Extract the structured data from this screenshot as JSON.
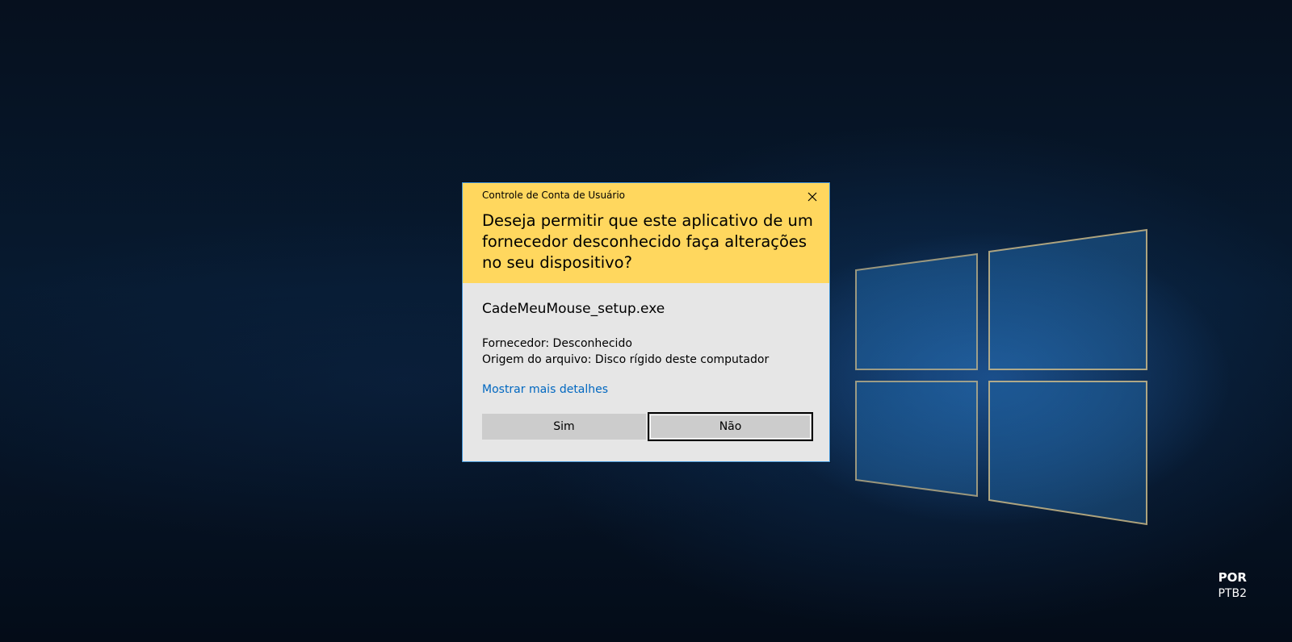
{
  "dialog": {
    "title": "Controle de Conta de Usuário",
    "question": "Deseja permitir que este aplicativo de um fornecedor desconhecido faça alterações no seu dispositivo?",
    "program_name": "CadeMeuMouse_setup.exe",
    "publisher_line": "Fornecedor: Desconhecido",
    "origin_line": "Origem do arquivo: Disco rígido deste computador",
    "more_details_label": "Mostrar mais detalhes",
    "yes_label": "Sim",
    "no_label": "Não",
    "close_icon": "close-icon",
    "header_color": "#ffd75e",
    "link_color": "#0067c0"
  },
  "language_indicator": {
    "code": "POR",
    "variant": "PTB2"
  }
}
